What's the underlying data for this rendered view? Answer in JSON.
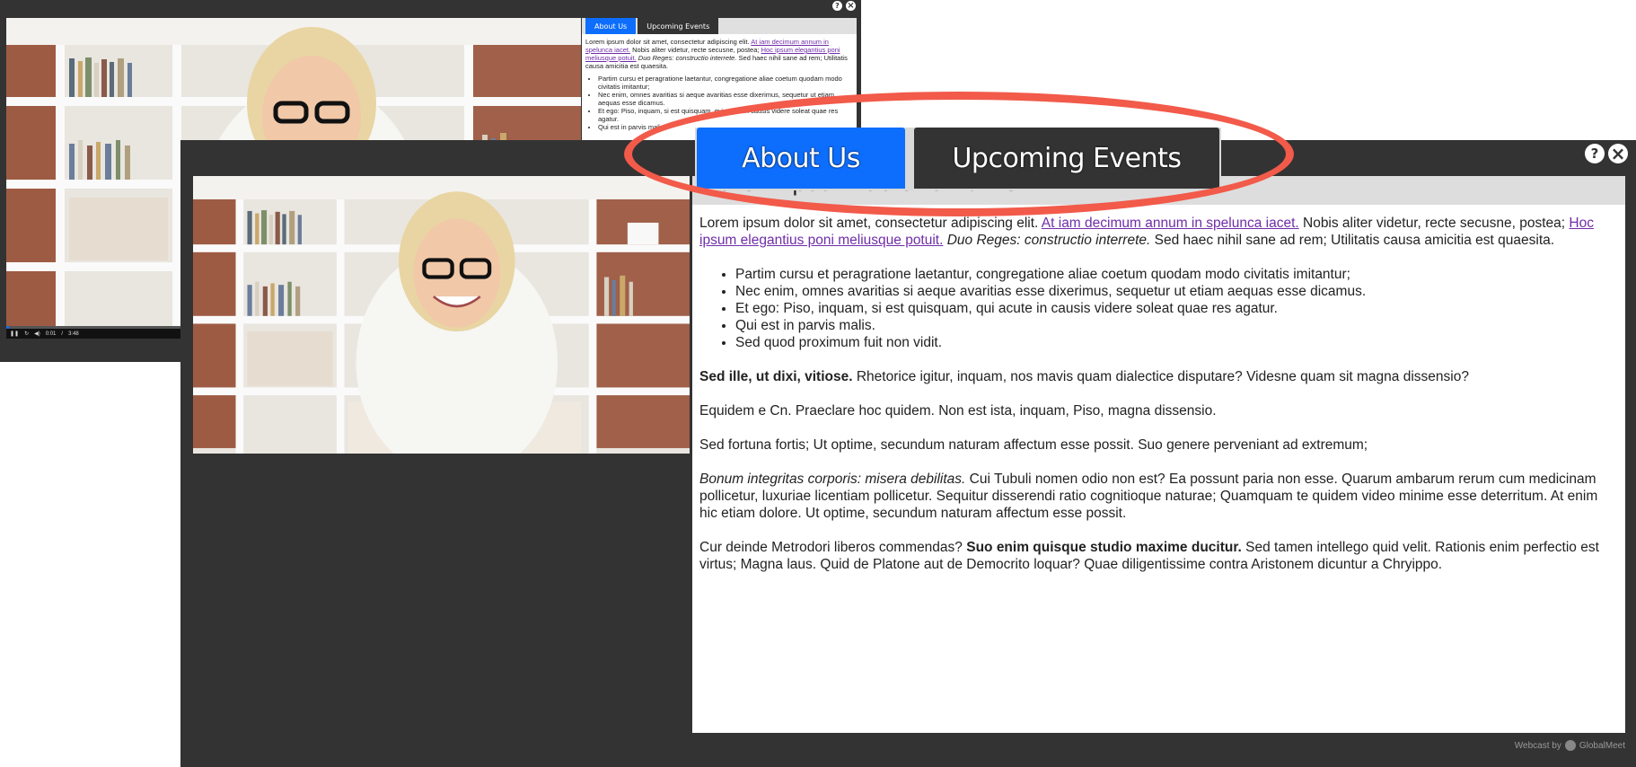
{
  "bg_window": {
    "tabs": [
      {
        "label": "About Us",
        "active": true
      },
      {
        "label": "Upcoming Events",
        "active": false
      }
    ],
    "help_icon": "?",
    "close_icon": "×",
    "player": {
      "time_current": "0:01",
      "time_separator": "/",
      "time_total": "3:48",
      "progress": 0.005
    },
    "content": {
      "p1_start": "Lorem ipsum dolor sit amet, consectetur adipiscing elit.",
      "p1_link1": "At iam decimum annum in spelunca iacet.",
      "p1_mid": "Nobis aliter videtur, recte secusne, postea;",
      "p1_link2": "Hoc ipsum elegantius poni meliusque potuit.",
      "p1_italic": "Duo Reges: constructio interrete.",
      "p1_end": "Sed haec nihil sane ad rem; Utilitatis causa amicitia est quaesita.",
      "bullets": [
        "Partim cursu et peragratione laetantur, congregatione aliae coetum quodam modo civitatis imitantur;",
        "Nec enim, omnes avaritias si aeque avaritias esse dixerimus, sequetur ut etiam aequas esse dicamus.",
        "Et ego: Piso, inquam, si est quisquam, qui acute in causis videre soleat quae res agatur.",
        "Qui est in parvis malis."
      ]
    }
  },
  "fg_window": {
    "tabs": [
      {
        "label": "About Us",
        "active": true
      },
      {
        "label": "Upcoming Events",
        "active": false
      }
    ],
    "help_icon": "?",
    "close_icon": "×",
    "heading_partial": "Lorem ipsum dolor sit amet",
    "content": {
      "p1_start": "Lorem ipsum dolor sit amet, consectetur adipiscing elit.",
      "p1_link1": "At iam decimum annum in spelunca iacet.",
      "p1_mid": "Nobis aliter videtur, recte secusne, postea;",
      "p1_link2": "Hoc ipsum elegantius poni meliusque potuit.",
      "p1_italic": "Duo Reges: constructio interrete.",
      "p1_end": "Sed haec nihil sane ad rem; Utilitatis causa amicitia est quaesita.",
      "bullets": [
        "Partim cursu et peragratione laetantur, congregatione aliae coetum quodam modo civitatis imitantur;",
        "Nec enim, omnes avaritias si aeque avaritias esse dixerimus, sequetur ut etiam aequas esse dicamus.",
        "Et ego: Piso, inquam, si est quisquam, qui acute in causis videre soleat quae res agatur.",
        "Qui est in parvis malis.",
        "Sed quod proximum fuit non vidit."
      ],
      "p2_bold": "Sed ille, ut dixi, vitiose.",
      "p2_rest": "Rhetorice igitur, inquam, nos mavis quam dialectice disputare? Videsne quam sit magna dissensio?",
      "p3": "Equidem e Cn. Praeclare hoc quidem. Non est ista, inquam, Piso, magna dissensio.",
      "p4": "Sed fortuna fortis; Ut optime, secundum naturam affectum esse possit. Suo genere perveniant ad extremum;",
      "p5_italic": "Bonum integritas corporis: misera debilitas.",
      "p5_rest": "Cui Tubuli nomen odio non est? Ea possunt paria non esse. Quarum ambarum rerum cum medicinam pollicetur, luxuriae licentiam pollicetur. Sequitur disserendi ratio cognitioque naturae; Quamquam te quidem video minime esse deterritum. At enim hic etiam dolore. Ut optime, secundum naturam affectum esse possit.",
      "p6_start": "Cur deinde Metrodori liberos commendas?",
      "p6_bold": "Suo enim quisque studio maxime ducitur.",
      "p6_end": "Sed tamen intellego quid velit. Rationis enim perfectio est virtus; Magna laus. Quid de Platone aut de Democrito loquar? Quae diligentissime contra Aristonem dicuntur a Chryippo."
    },
    "footer": {
      "webcast_by": "Webcast by",
      "brand": "GlobalMeet"
    }
  },
  "zoom_callout": {
    "tabs": [
      {
        "label": "About Us",
        "active": true
      },
      {
        "label": "Upcoming Events",
        "active": false
      }
    ]
  },
  "colors": {
    "panel_bg": "#333333",
    "tab_active": "#0d6efd",
    "tab_inactive": "#333333",
    "link": "#6f2da8",
    "highlight": "#f25a4a"
  }
}
